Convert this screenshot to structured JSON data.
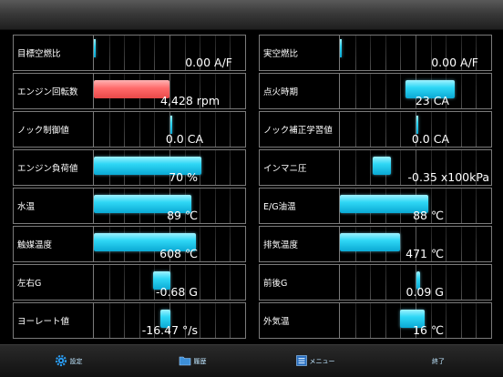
{
  "gauges": [
    {
      "label": "目標空燃比",
      "value": "0.00 A/F",
      "fill": 0.0,
      "style": "thin"
    },
    {
      "label": "実空燃比",
      "value": "0.00 A/F",
      "fill": 0.0,
      "style": "thin"
    },
    {
      "label": "エンジン回転数",
      "value": "4,428 rpm",
      "fill": 0.49,
      "style": "red"
    },
    {
      "label": "点火時期",
      "value": "23 CA",
      "center_value": 0.0,
      "style": "blue"
    },
    {
      "label": "ノック制御値",
      "value": "0.0 CA",
      "style": "tick_only"
    },
    {
      "label": "ノック補正学習値",
      "value": "0.0 CA",
      "style": "tick_only"
    },
    {
      "label": "エンジン負荷値",
      "value": "70 %",
      "fill": 0.7,
      "style": "blue"
    },
    {
      "label": "インマニ圧",
      "value": "-0.35 x100kPa",
      "style": "blue"
    },
    {
      "label": "水温",
      "value": "89 ℃",
      "fill": 0.64,
      "style": "blue"
    },
    {
      "label": "E/G油温",
      "value": "88 ℃",
      "fill": 0.58,
      "style": "blue"
    },
    {
      "label": "触媒温度",
      "value": "608 ℃",
      "fill": 0.66,
      "style": "blue"
    },
    {
      "label": "排気温度",
      "value": "471 ℃",
      "fill": 0.4,
      "style": "blue"
    },
    {
      "label": "左右G",
      "value": "-0.68 G",
      "style": "blue"
    },
    {
      "label": "前後G",
      "value": "0.09 G",
      "style": "blue"
    },
    {
      "label": "ヨーレート値",
      "value": "-16.47 °/s",
      "style": "blue"
    },
    {
      "label": "外気温",
      "value": "16 ℃",
      "style": "blue"
    }
  ],
  "toolbar": {
    "settings_label": "設定",
    "history_label": "履歴",
    "menu_label": "メニュー",
    "exit_label": "終了"
  },
  "colors": {
    "bar_blue": "#2fd7f5",
    "bar_red": "#ff6a6a",
    "toolbar_icon": "#2a9df4"
  },
  "icons": [
    "gear-icon",
    "folder-icon",
    "menu-icon"
  ]
}
